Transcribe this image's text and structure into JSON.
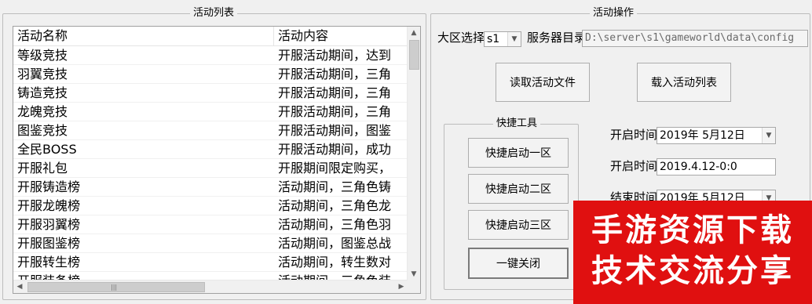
{
  "list_panel": {
    "title": "活动列表",
    "columns": [
      "活动名称",
      "活动内容"
    ],
    "rows": [
      {
        "name": "等级竞技",
        "content": "开服活动期间，达到"
      },
      {
        "name": "羽翼竞技",
        "content": "开服活动期间，三角"
      },
      {
        "name": "铸造竞技",
        "content": "开服活动期间，三角"
      },
      {
        "name": "龙魄竞技",
        "content": "开服活动期间，三角"
      },
      {
        "name": "图鉴竞技",
        "content": "开服活动期间，图鉴"
      },
      {
        "name": "全民BOSS",
        "content": "开服活动期间，成功"
      },
      {
        "name": "开服礼包",
        "content": "开服期间限定购买，"
      },
      {
        "name": "开服铸造榜",
        "content": "活动期间，三角色铸"
      },
      {
        "name": "开服龙魄榜",
        "content": "活动期间，三角色龙"
      },
      {
        "name": "开服羽翼榜",
        "content": "活动期间，三角色羽"
      },
      {
        "name": "开服图鉴榜",
        "content": "活动期间，图鉴总战"
      },
      {
        "name": "开服转生榜",
        "content": "活动期间，转生数对"
      },
      {
        "name": "开服装备榜",
        "content": "活动期间，三角色装"
      }
    ]
  },
  "ops_panel": {
    "title": "活动操作",
    "region_label": "大区选择",
    "region_value": "s1",
    "server_dir_label": "服务器目录",
    "server_dir_value": "D:\\server\\s1\\gameworld\\data\\config",
    "read_button": "读取活动文件",
    "load_button": "载入活动列表",
    "tools": {
      "title": "快捷工具",
      "buttons": [
        "快捷启动一区",
        "快捷启动二区",
        "快捷启动三区",
        "一键关闭"
      ]
    },
    "start_time_label": "开启时间",
    "start_date_value": "2019年 5月12日",
    "start_time_label_2": "开启时间",
    "start_time_text": "2019.4.12-0:0",
    "end_time_label": "结束时间",
    "end_date_value": "2019年 5月12日"
  },
  "watermark": {
    "line1": "手游资源下载",
    "line2": "技术交流分享",
    "color": "#e01010"
  }
}
